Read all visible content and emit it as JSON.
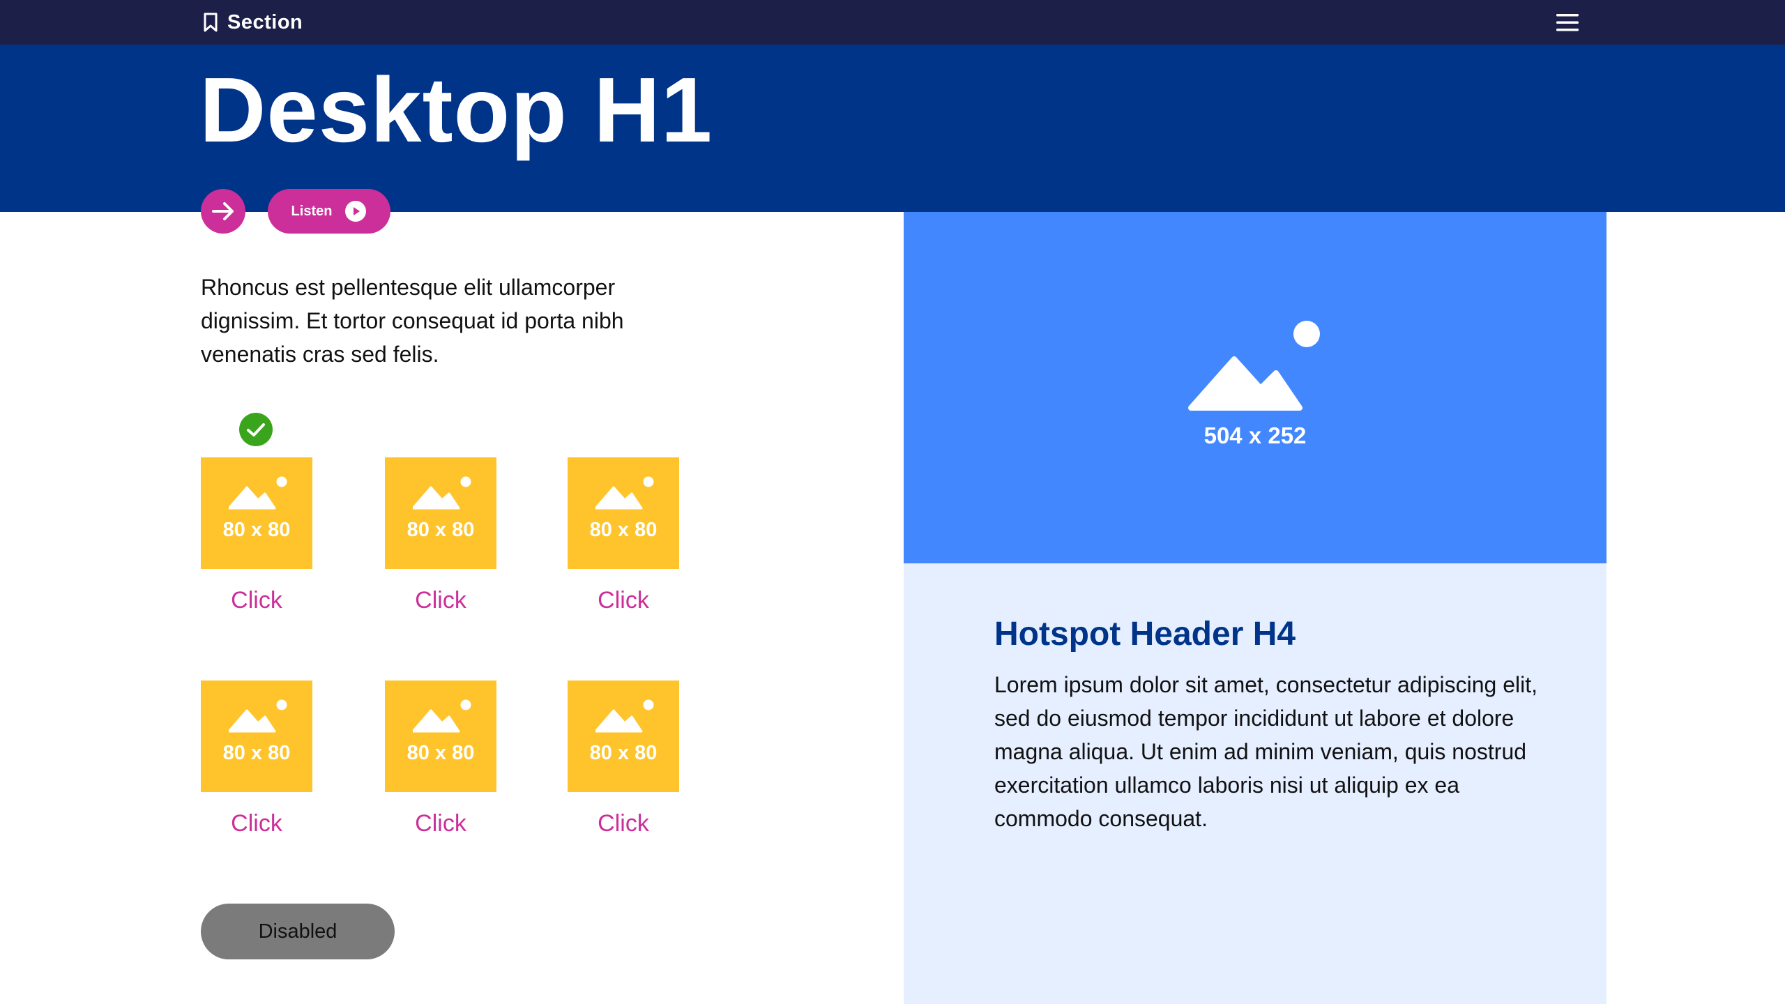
{
  "header": {
    "section_label": "Section",
    "section_icon": "bookmark-icon",
    "menu_icon": "hamburger-menu-icon",
    "background_color": "#1c1f47"
  },
  "hero": {
    "title": "Desktop H1",
    "background_color": "#003489"
  },
  "actions": {
    "next_icon": "arrow-right-icon",
    "listen_label": "Listen",
    "listen_icon": "play-icon",
    "accent_color": "#cc2e9a"
  },
  "intro": {
    "text": "Rhoncus est pellentesque elit ullamcorper dignissim. Et tortor consequat id porta nibh venenatis cras sed felis."
  },
  "hotspots": [
    {
      "size_label": "80 x 80",
      "click_label": "Click",
      "visited": true
    },
    {
      "size_label": "80 x 80",
      "click_label": "Click",
      "visited": false
    },
    {
      "size_label": "80 x 80",
      "click_label": "Click",
      "visited": false
    },
    {
      "size_label": "80 x 80",
      "click_label": "Click",
      "visited": false
    },
    {
      "size_label": "80 x 80",
      "click_label": "Click",
      "visited": false
    },
    {
      "size_label": "80 x 80",
      "click_label": "Click",
      "visited": false
    }
  ],
  "hotspot_style": {
    "thumbnail_color": "#ffc42c",
    "thumbnail_icon": "image-placeholder-icon",
    "visited_icon": "check-circle-icon",
    "visited_color": "#3aa51c"
  },
  "disabled_button": {
    "label": "Disabled",
    "color": "#7b7b7b"
  },
  "media": {
    "size_label": "504 x 252",
    "icon": "image-placeholder-icon",
    "background_color": "#4287fe"
  },
  "info_panel": {
    "title": "Hotspot Header H4",
    "body": "Lorem ipsum dolor sit amet, consectetur adipiscing elit, sed do eiusmod tempor incididunt ut labore et dolore magna aliqua. Ut enim ad minim veniam, quis nostrud exercitation ullamco laboris nisi ut aliquip ex ea commodo consequat.",
    "background_color": "#e6efff"
  }
}
